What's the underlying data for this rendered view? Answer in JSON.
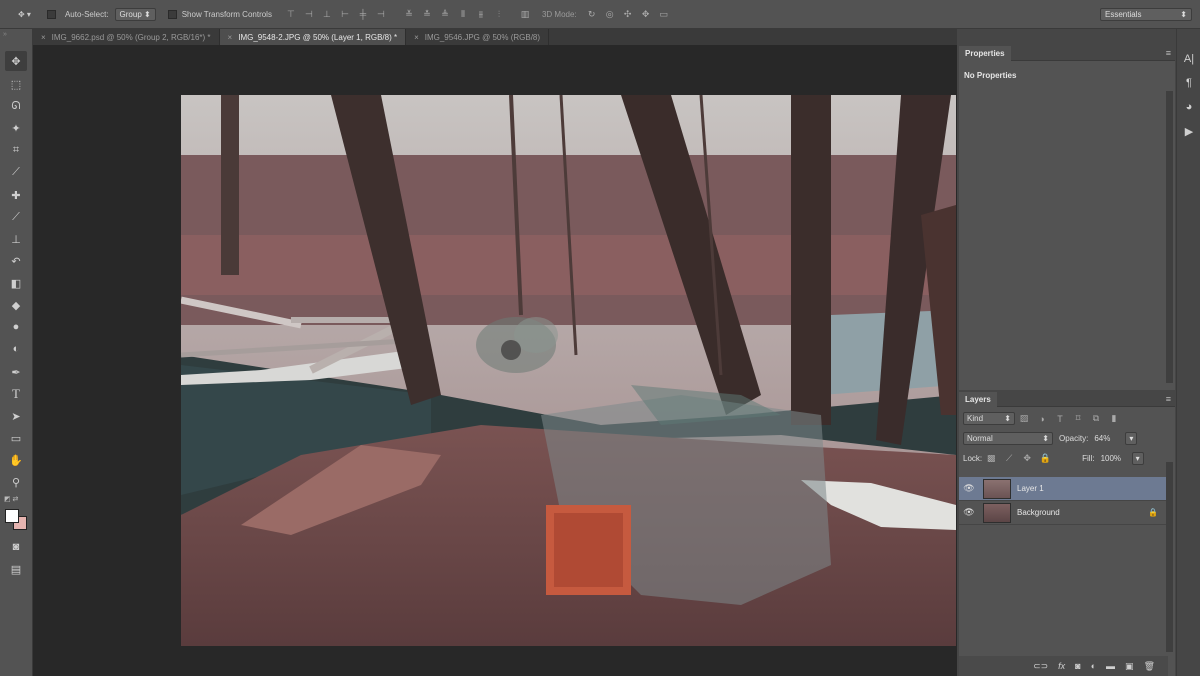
{
  "options_bar": {
    "auto_select_label": "Auto-Select:",
    "auto_select_value": "Group",
    "show_transform_label": "Show Transform Controls",
    "mode_3d_label": "3D Mode:",
    "workspace": "Essentials"
  },
  "tabs": [
    {
      "label": "IMG_9662.psd @ 50% (Group 2, RGB/16*) *",
      "active": false
    },
    {
      "label": "IMG_9548-2.JPG @ 50% (Layer 1, RGB/8) *",
      "active": true
    },
    {
      "label": "IMG_9546.JPG @ 50% (RGB/8)",
      "active": false
    }
  ],
  "properties": {
    "title": "Properties",
    "content": "No Properties"
  },
  "layers": {
    "title": "Layers",
    "filter_kind": "Kind",
    "blend_mode": "Normal",
    "opacity_label": "Opacity:",
    "opacity_value": "64%",
    "lock_label": "Lock:",
    "fill_label": "Fill:",
    "fill_value": "100%",
    "items": [
      {
        "name": "Layer 1",
        "selected": true
      },
      {
        "name": "Background",
        "selected": false
      }
    ]
  },
  "tools_icons": [
    "move-icon",
    "marquee-icon",
    "lasso-icon",
    "magic-wand-icon",
    "crop-icon",
    "eyedropper-icon",
    "healing-brush-icon",
    "brush-icon",
    "clone-stamp-icon",
    "history-brush-icon",
    "eraser-icon",
    "paint-bucket-icon",
    "blur-icon",
    "dodge-icon",
    "pen-icon",
    "type-icon",
    "path-select-icon",
    "rectangle-icon",
    "hand-icon",
    "zoom-icon"
  ],
  "colors": {
    "selected_layer": "#6d7a92",
    "foreground": "#ffffff",
    "background": "#e6b4b0"
  }
}
